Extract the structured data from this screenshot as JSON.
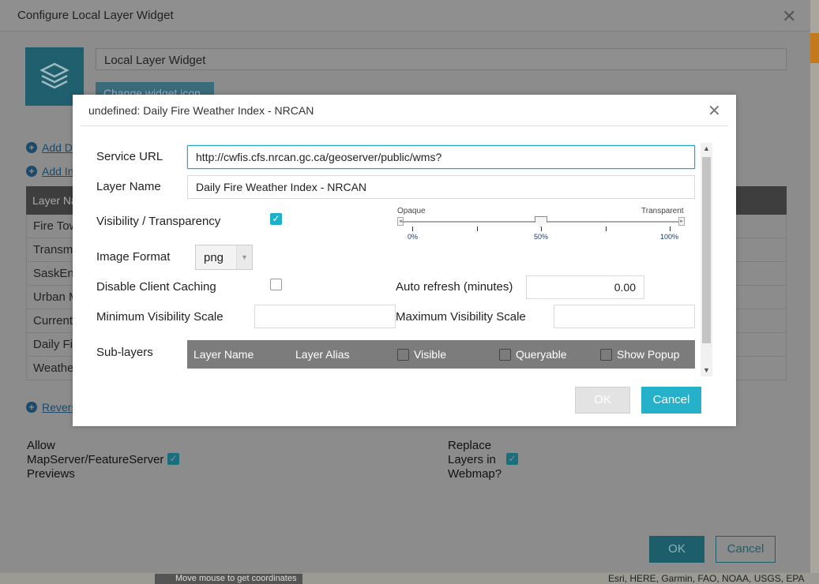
{
  "outer_dialog": {
    "title": "Configure Local Layer Widget",
    "widget_name": "Local Layer Widget",
    "change_icon_label": "Change widget icon",
    "add_links": [
      "Add D",
      "Add In"
    ],
    "table_header": "Layer Na",
    "table_rows": [
      "Fire Tow",
      "Transmi",
      "SaskEne",
      "Urban M",
      "Current",
      "Daily Fi",
      "Weathe"
    ],
    "reverse_link": "Revers",
    "allow_previews_label": [
      "Allow",
      "MapServer/FeatureServer",
      "Previews"
    ],
    "replace_layers_label": [
      "Replace",
      "Layers in",
      "Webmap?"
    ],
    "ok_label": "OK",
    "cancel_label": "Cancel"
  },
  "modal": {
    "title": "undefined: Daily Fire Weather Index - NRCAN",
    "service_url_label": "Service URL",
    "service_url_value": "http://cwfis.cfs.nrcan.gc.ca/geoserver/public/wms?",
    "layer_name_label": "Layer Name",
    "layer_name_value": "Daily Fire Weather Index - NRCAN",
    "visibility_label": "Visibility / Transparency",
    "visibility_checked": true,
    "transparency": {
      "left_label": "Opaque",
      "right_label": "Transparent",
      "ticks": [
        "0%",
        "50%",
        "100%"
      ],
      "value_percent": 50
    },
    "image_format_label": "Image Format",
    "image_format_value": "png",
    "disable_caching_label": "Disable Client Caching",
    "disable_caching_checked": false,
    "auto_refresh_label": "Auto refresh (minutes)",
    "auto_refresh_value": "0.00",
    "min_scale_label": "Minimum Visibility Scale",
    "min_scale_value": "",
    "max_scale_label": "Maximum Visibility Scale",
    "max_scale_value": "",
    "sublayers_label": "Sub-layers",
    "sublayers_columns": {
      "name": "Layer Name",
      "alias": "Layer Alias",
      "visible": "Visible",
      "queryable": "Queryable",
      "popup": "Show Popup"
    },
    "ok_label": "OK",
    "cancel_label": "Cancel"
  },
  "map_footer": {
    "coordinates_hint": "Move mouse to get coordinates",
    "attribution": "Esri, HERE, Garmin, FAO, NOAA, USGS, EPA"
  },
  "colors": {
    "accent": "#24b1c9",
    "overlay": "#8c8c8c",
    "dark_accent": "#1c5e6a"
  }
}
